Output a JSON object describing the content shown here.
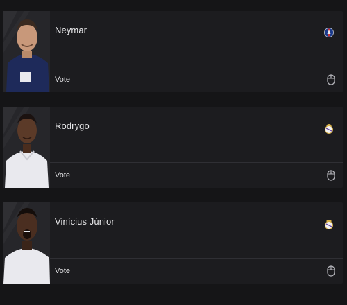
{
  "players": [
    {
      "name": "Neymar",
      "vote_label": "Vote",
      "club_crest": "psg-crest-icon"
    },
    {
      "name": "Rodrygo",
      "vote_label": "Vote",
      "club_crest": "real-madrid-crest-icon"
    },
    {
      "name": "Vinícius Júnior",
      "vote_label": "Vote",
      "club_crest": "real-madrid-crest-icon"
    }
  ],
  "colors": {
    "background": "#151517",
    "card": "#1c1c1f",
    "divider": "#2f2f34",
    "text": "#e8e8ea",
    "psg_blue": "#1b3a8c",
    "real_madrid_gold": "#d9b24a"
  },
  "icons": {
    "vote": "mouse-icon"
  }
}
